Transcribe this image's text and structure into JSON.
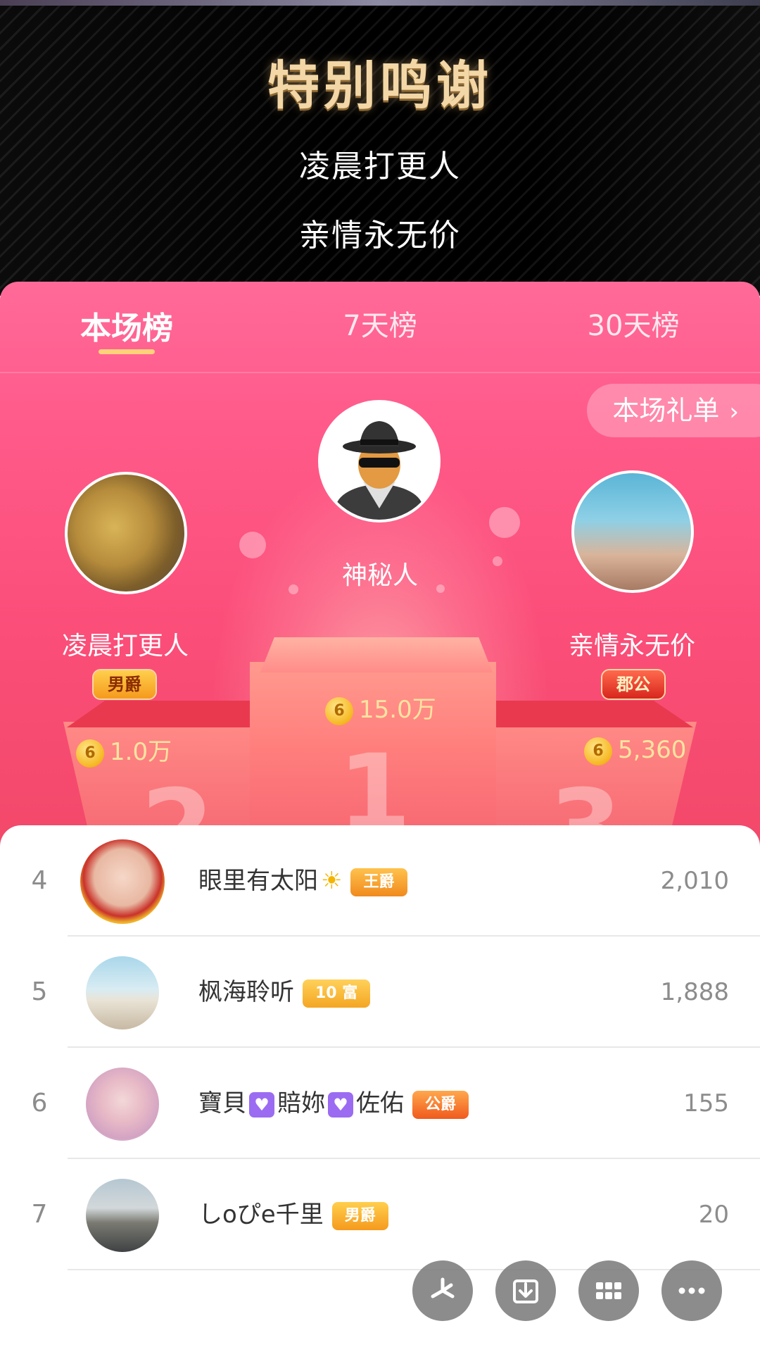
{
  "banner": {
    "title": "特别鸣谢",
    "lines": [
      "凌晨打更人",
      "亲情永无价"
    ]
  },
  "tabs": [
    {
      "label": "本场榜",
      "active": true
    },
    {
      "label": "7天榜",
      "active": false
    },
    {
      "label": "30天榜",
      "active": false
    }
  ],
  "gift_list_button": {
    "label": "本场礼单",
    "chevron": "›"
  },
  "podium": [
    {
      "rank": 1,
      "name": "神秘人",
      "coins": "15.0万",
      "badge": null,
      "avatar": "mystery-man-avatar"
    },
    {
      "rank": 2,
      "name": "凌晨打更人",
      "coins": "1.0万",
      "badge": "男爵",
      "avatar": "gong-avatar"
    },
    {
      "rank": 3,
      "name": "亲情永无价",
      "coins": "5,360",
      "badge": "郡公",
      "avatar": "couple-avatar"
    }
  ],
  "podium_numbers": [
    "1",
    "2",
    "3"
  ],
  "coin_glyph": "6",
  "list": [
    {
      "rank": "4",
      "name": "眼里有太阳",
      "emoji": "☀",
      "badge": "王爵",
      "badge_style": "gold",
      "score": "2,010"
    },
    {
      "rank": "5",
      "name": "枫海聆听",
      "badge": "10 富",
      "badge_style": "rich",
      "score": "1,888"
    },
    {
      "rank": "6",
      "name_parts": [
        "寶貝",
        "賠妳",
        "佐佑"
      ],
      "heart": "♥",
      "badge": "公爵",
      "badge_style": "orange",
      "score": "155"
    },
    {
      "rank": "7",
      "name": "しoぴe千里",
      "badge": "男爵",
      "badge_style": "gold",
      "score": "20"
    }
  ],
  "fabs": [
    "pinwheel-icon",
    "download-icon",
    "grid-icon",
    "more-icon"
  ],
  "colors": {
    "pink_top": "#ff6a99",
    "pink_bottom": "#f24868",
    "title_gold": "#f3d7a6",
    "coin_text": "#ffe3a0",
    "tab_underline": "#ffd27a"
  }
}
